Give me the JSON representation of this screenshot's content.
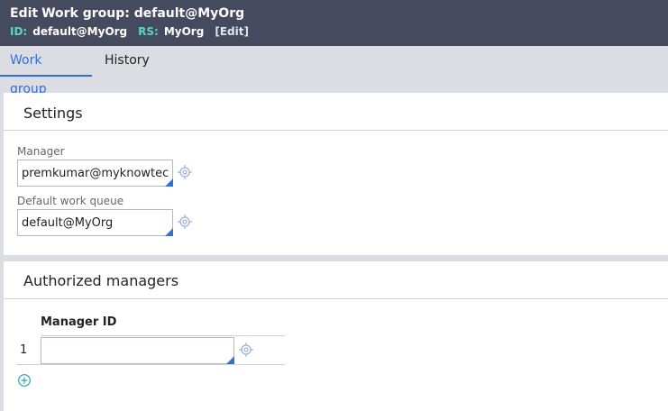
{
  "header": {
    "edit": "Edit",
    "title": "Work group: default@MyOrg",
    "id_label": "ID:",
    "id_value": "default@MyOrg",
    "rs_label": "RS:",
    "rs_value": "MyOrg",
    "edit_link": "[Edit]"
  },
  "tabs": [
    {
      "label": "Work group",
      "active": true
    },
    {
      "label": "History",
      "active": false
    }
  ],
  "settings": {
    "title": "Settings",
    "manager_label": "Manager",
    "manager_value": "premkumar@myknowtec",
    "queue_label": "Default work queue",
    "queue_value": "default@MyOrg",
    "icon": "crosshair-icon"
  },
  "managers": {
    "title": "Authorized managers",
    "column": "Manager ID",
    "rows": [
      {
        "num": "1",
        "value": ""
      }
    ],
    "add_icon": "plus-circle-icon"
  },
  "colors": {
    "header_bg": "#454a5e",
    "accent": "#2f6fe0",
    "id_label": "#5fd3c6"
  }
}
